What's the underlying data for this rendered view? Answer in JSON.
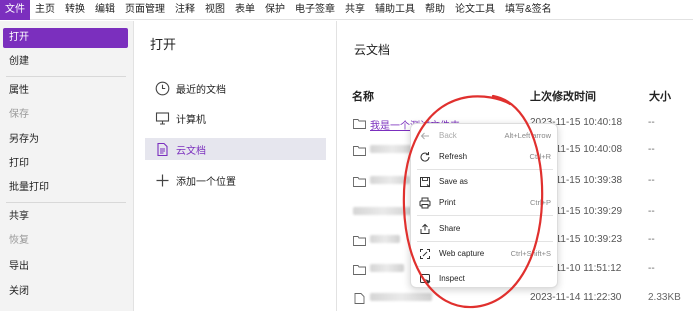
{
  "menubar": {
    "items": [
      "文件",
      "主页",
      "转换",
      "编辑",
      "页面管理",
      "注释",
      "视图",
      "表单",
      "保护",
      "电子签章",
      "共享",
      "辅助工具",
      "帮助",
      "论文工具",
      "填写&签名"
    ]
  },
  "leftnav": {
    "items": [
      {
        "label": "打开",
        "active": true
      },
      {
        "label": "创建"
      },
      {
        "label": "属性"
      },
      {
        "label": "保存",
        "disabled": true
      },
      {
        "label": "另存为"
      },
      {
        "label": "打印"
      },
      {
        "label": "批量打印"
      },
      {
        "label": "共享"
      },
      {
        "label": "恢复",
        "disabled": true
      },
      {
        "label": "导出"
      },
      {
        "label": "关闭"
      }
    ]
  },
  "middle": {
    "title": "打开",
    "locations": [
      {
        "label": "最近的文档",
        "icon": "clock-icon"
      },
      {
        "label": "计算机",
        "icon": "computer-icon"
      },
      {
        "label": "云文档",
        "icon": "cloud-document-icon",
        "active": true
      },
      {
        "label": "添加一个位置",
        "icon": "plus-icon"
      }
    ]
  },
  "right": {
    "title": "云文档",
    "columns": {
      "name": "名称",
      "modified": "上次修改时间",
      "size": "大小"
    },
    "rows": [
      {
        "name": "我是一个测试文件夹",
        "date": "2023-11-15 10:40:18",
        "size": "--"
      },
      {
        "name": "",
        "date": "2023-11-15 10:40:08",
        "size": "--"
      },
      {
        "name": "",
        "date": "2023-11-15 10:39:38",
        "size": "--"
      },
      {
        "name": "",
        "date": "2023-11-15 10:39:29",
        "size": "--"
      },
      {
        "name": "",
        "date": "2023-11-15 10:39:23",
        "size": "--"
      },
      {
        "name": "",
        "date": "2023-11-10 11:51:12",
        "size": "--"
      },
      {
        "name": "",
        "date": "2023-11-14 11:22:30",
        "size": "2.33KB"
      }
    ]
  },
  "context_menu": {
    "items": [
      {
        "label": "Back",
        "shortcut": "Alt+Left arrow",
        "disabled": true,
        "icon": "back-arrow-icon"
      },
      {
        "label": "Refresh",
        "shortcut": "Ctrl+R",
        "icon": "refresh-icon"
      },
      {
        "label": "Save as",
        "shortcut": "",
        "icon": "save-icon"
      },
      {
        "label": "Print",
        "shortcut": "Ctrl+P",
        "icon": "print-icon"
      },
      {
        "label": "Share",
        "shortcut": "",
        "icon": "share-icon"
      },
      {
        "label": "Web capture",
        "shortcut": "Ctrl+Shift+S",
        "icon": "web-capture-icon"
      },
      {
        "label": "Inspect",
        "shortcut": "",
        "icon": "inspect-icon"
      }
    ]
  },
  "colors": {
    "accent": "#7b2fbe",
    "annotation": "#e0302e"
  }
}
